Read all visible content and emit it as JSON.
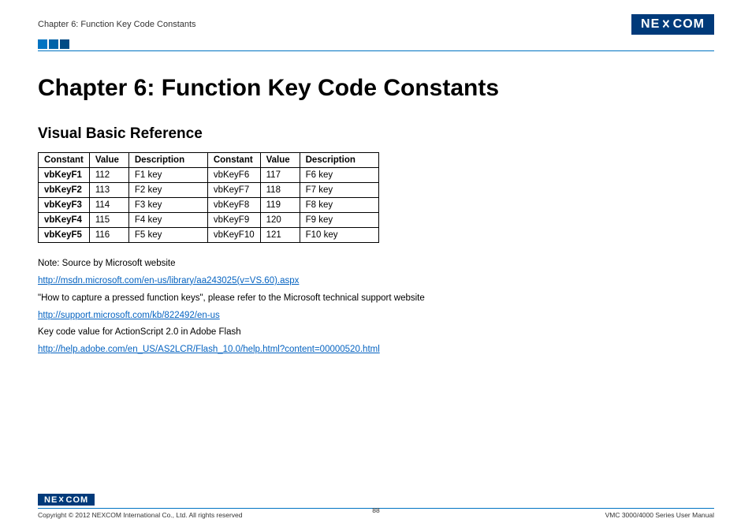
{
  "header": {
    "breadcrumb": "Chapter 6: Function Key Code Constants",
    "logo_text": "NEXCOM"
  },
  "chapter_title": "Chapter 6: Function Key Code Constants",
  "section_title": "Visual Basic Reference",
  "table": {
    "headers": [
      "Constant",
      "Value",
      "Description",
      "Constant",
      "Value",
      "Description"
    ],
    "rows": [
      [
        "vbKeyF1",
        "112",
        "F1 key",
        "vbKeyF6",
        "117",
        "F6 key"
      ],
      [
        "vbKeyF2",
        "113",
        "F2 key",
        "vbKeyF7",
        "118",
        "F7 key"
      ],
      [
        "vbKeyF3",
        "114",
        "F3 key",
        "vbKeyF8",
        "119",
        "F8 key"
      ],
      [
        "vbKeyF4",
        "115",
        "F4 key",
        "vbKeyF9",
        "120",
        "F9 key"
      ],
      [
        "vbKeyF5",
        "116",
        "F5 key",
        "vbKeyF10",
        "121",
        "F10 key"
      ]
    ]
  },
  "notes": {
    "line1": "Note: Source by Microsoft website",
    "link1": "http://msdn.microsoft.com/en-us/library/aa243025(v=VS.60).aspx",
    "line2": "\"How to capture a pressed function keys\", please refer to the Microsoft technical support website",
    "link2": "http://support.microsoft.com/kb/822492/en-us",
    "line3": "Key code value for ActionScript 2.0 in Adobe Flash",
    "link3": "http://help.adobe.com/en_US/AS2LCR/Flash_10.0/help.html?content=00000520.html"
  },
  "footer": {
    "logo_text": "NEXCOM",
    "copyright": "Copyright © 2012 NEXCOM International Co., Ltd. All rights reserved",
    "page_number": "88",
    "manual": "VMC 3000/4000 Series User Manual"
  },
  "chart_data": {
    "type": "table",
    "title": "Visual Basic Reference – Function Key Code Constants",
    "columns": [
      "Constant",
      "Value",
      "Description"
    ],
    "rows": [
      {
        "Constant": "vbKeyF1",
        "Value": 112,
        "Description": "F1 key"
      },
      {
        "Constant": "vbKeyF2",
        "Value": 113,
        "Description": "F2 key"
      },
      {
        "Constant": "vbKeyF3",
        "Value": 114,
        "Description": "F3 key"
      },
      {
        "Constant": "vbKeyF4",
        "Value": 115,
        "Description": "F4 key"
      },
      {
        "Constant": "vbKeyF5",
        "Value": 116,
        "Description": "F5 key"
      },
      {
        "Constant": "vbKeyF6",
        "Value": 117,
        "Description": "F6 key"
      },
      {
        "Constant": "vbKeyF7",
        "Value": 118,
        "Description": "F7 key"
      },
      {
        "Constant": "vbKeyF8",
        "Value": 119,
        "Description": "F8 key"
      },
      {
        "Constant": "vbKeyF9",
        "Value": 120,
        "Description": "F9 key"
      },
      {
        "Constant": "vbKeyF10",
        "Value": 121,
        "Description": "F10 key"
      }
    ]
  }
}
